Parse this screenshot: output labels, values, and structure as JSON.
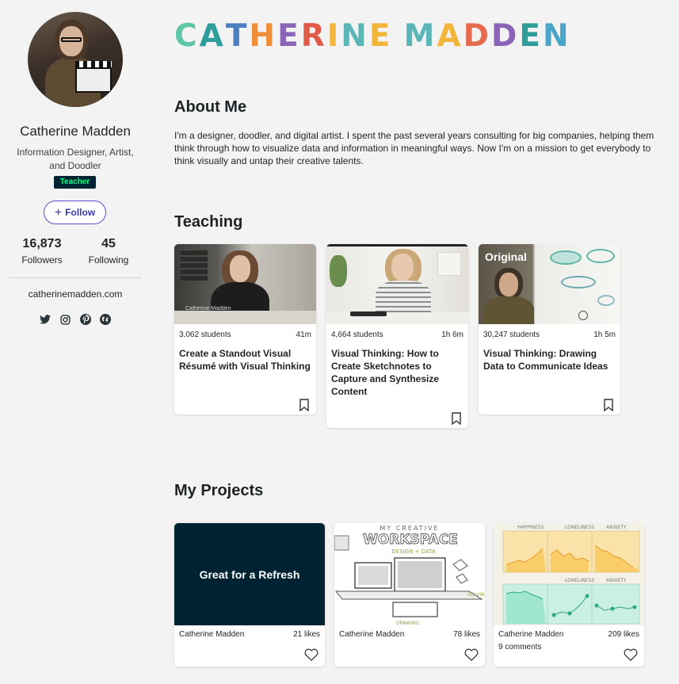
{
  "profile": {
    "name": "Catherine Madden",
    "headline": "Information Designer, Artist, and Doodler",
    "badge": "Teacher",
    "follow_label": "Follow",
    "followers_count": "16,873",
    "followers_label": "Followers",
    "following_count": "45",
    "following_label": "Following",
    "website": "catherinemadden.com",
    "social_icons": [
      "twitter-icon",
      "instagram-icon",
      "pinterest-icon",
      "globe-icon"
    ]
  },
  "brand": {
    "letters": [
      "C",
      "A",
      "T",
      "H",
      "E",
      "R",
      "I",
      "N",
      "E",
      " ",
      "M",
      "A",
      "D",
      "D",
      "E",
      "N"
    ],
    "colors": [
      "#5cc6a7",
      "#2f9e9a",
      "#4a7fc1",
      "#f08f3b",
      "#8a64b7",
      "#e05b4a",
      "#f2b63a",
      "#5cb6b8",
      "#f2b63a",
      "",
      "#5cb6b8",
      "#f2b63a",
      "#e66a4e",
      "#8a64b7",
      "#2f9e9a",
      "#4aa6c9"
    ]
  },
  "about": {
    "heading": "About Me",
    "text": "I'm a designer, doodler, and digital artist. I spent the past several years consulting for big companies, helping them think through how to visualize data and information in meaningful ways. Now I'm on a mission to get everybody to think visually and untap their creative talents."
  },
  "teaching": {
    "heading": "Teaching",
    "courses": [
      {
        "students": "3,062 students",
        "duration": "41m",
        "title": "Create a Standout Visual Résumé with Visual Thinking",
        "thumb_caption": "Catherine Madden"
      },
      {
        "students": "4,664 students",
        "duration": "1h 6m",
        "title": "Visual Thinking: How to Create Sketchnotes to Capture and Synthesize Content"
      },
      {
        "students": "30,247 students",
        "duration": "1h 5m",
        "title": "Visual Thinking: Drawing Data to Communicate Ideas",
        "thumb_label": "Original"
      }
    ]
  },
  "projects": {
    "heading": "My Projects",
    "items": [
      {
        "thumb_text": "Great for a Refresh",
        "author": "Catherine Madden",
        "likes": "21 likes"
      },
      {
        "thumb_text": "MY CREATIVE WORKSPACE",
        "author": "Catherine Madden",
        "likes": "78 likes"
      },
      {
        "thumb_text": "",
        "author": "Catherine Madden",
        "likes": "209 likes",
        "comments": "9 comments"
      }
    ],
    "chart_labels": [
      "HAPPINESS",
      "LONELINESS",
      "ANXIETY"
    ]
  },
  "colors": {
    "badge_bg": "#002333",
    "badge_text": "#00ff84",
    "follow_accent": "#3a3bb0",
    "refresh_bg": "#002333"
  }
}
